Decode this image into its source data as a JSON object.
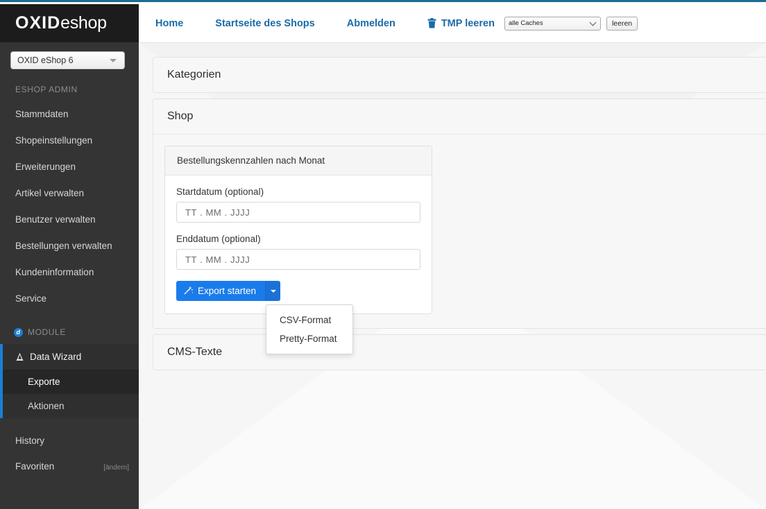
{
  "brand": {
    "logo_bold": "OXID",
    "logo_light": "eshop",
    "shop_selector_value": "OXID eShop 6"
  },
  "sidebar": {
    "admin_section_title": "ESHOP ADMIN",
    "items": [
      {
        "label": "Stammdaten"
      },
      {
        "label": "Shopeinstellungen"
      },
      {
        "label": "Erweiterungen"
      },
      {
        "label": "Artikel verwalten"
      },
      {
        "label": "Benutzer verwalten"
      },
      {
        "label": "Bestellungen verwalten"
      },
      {
        "label": "Kundeninformation"
      },
      {
        "label": "Service"
      }
    ],
    "module_section_title": "MODULE",
    "module_badge_glyph": "d",
    "module_group": {
      "parent_label": "Data Wizard",
      "parent_icon": "wizard-hat-icon",
      "children": [
        {
          "label": "Exporte",
          "selected": true
        },
        {
          "label": "Aktionen",
          "selected": false
        }
      ]
    },
    "bottom_items": [
      {
        "label": "History"
      }
    ],
    "favorites": {
      "label": "Favoriten",
      "edit_label": "[ändern]"
    }
  },
  "topbar": {
    "links": [
      {
        "label": "Home"
      },
      {
        "label": "Startseite des Shops"
      },
      {
        "label": "Abmelden"
      }
    ],
    "tmp_icon": "trash-icon",
    "tmp_label": "TMP leeren",
    "cache_select_value": "alle Caches",
    "clear_button_label": "leeren"
  },
  "main": {
    "panels": [
      {
        "title": "Kategorien"
      },
      {
        "title": "Shop"
      },
      {
        "title": "CMS-Texte"
      }
    ],
    "card": {
      "title": "Bestellungskennzahlen nach Monat",
      "start_date": {
        "label": "Startdatum (optional)",
        "value": "",
        "placeholder": "TT . MM . JJJJ"
      },
      "end_date": {
        "label": "Enddatum (optional)",
        "value": "",
        "placeholder": "TT . MM . JJJJ"
      },
      "export_button": {
        "label": "Export starten",
        "icon": "magic-wand-icon"
      },
      "dropdown": {
        "open": true,
        "items": [
          {
            "label": "CSV-Format"
          },
          {
            "label": "Pretty-Format"
          }
        ]
      }
    }
  },
  "colors": {
    "accent_blue": "#1a7ceb",
    "link_blue": "#1a6ba8",
    "sidebar_bg": "#343434",
    "top_border": "#1f6b94"
  }
}
